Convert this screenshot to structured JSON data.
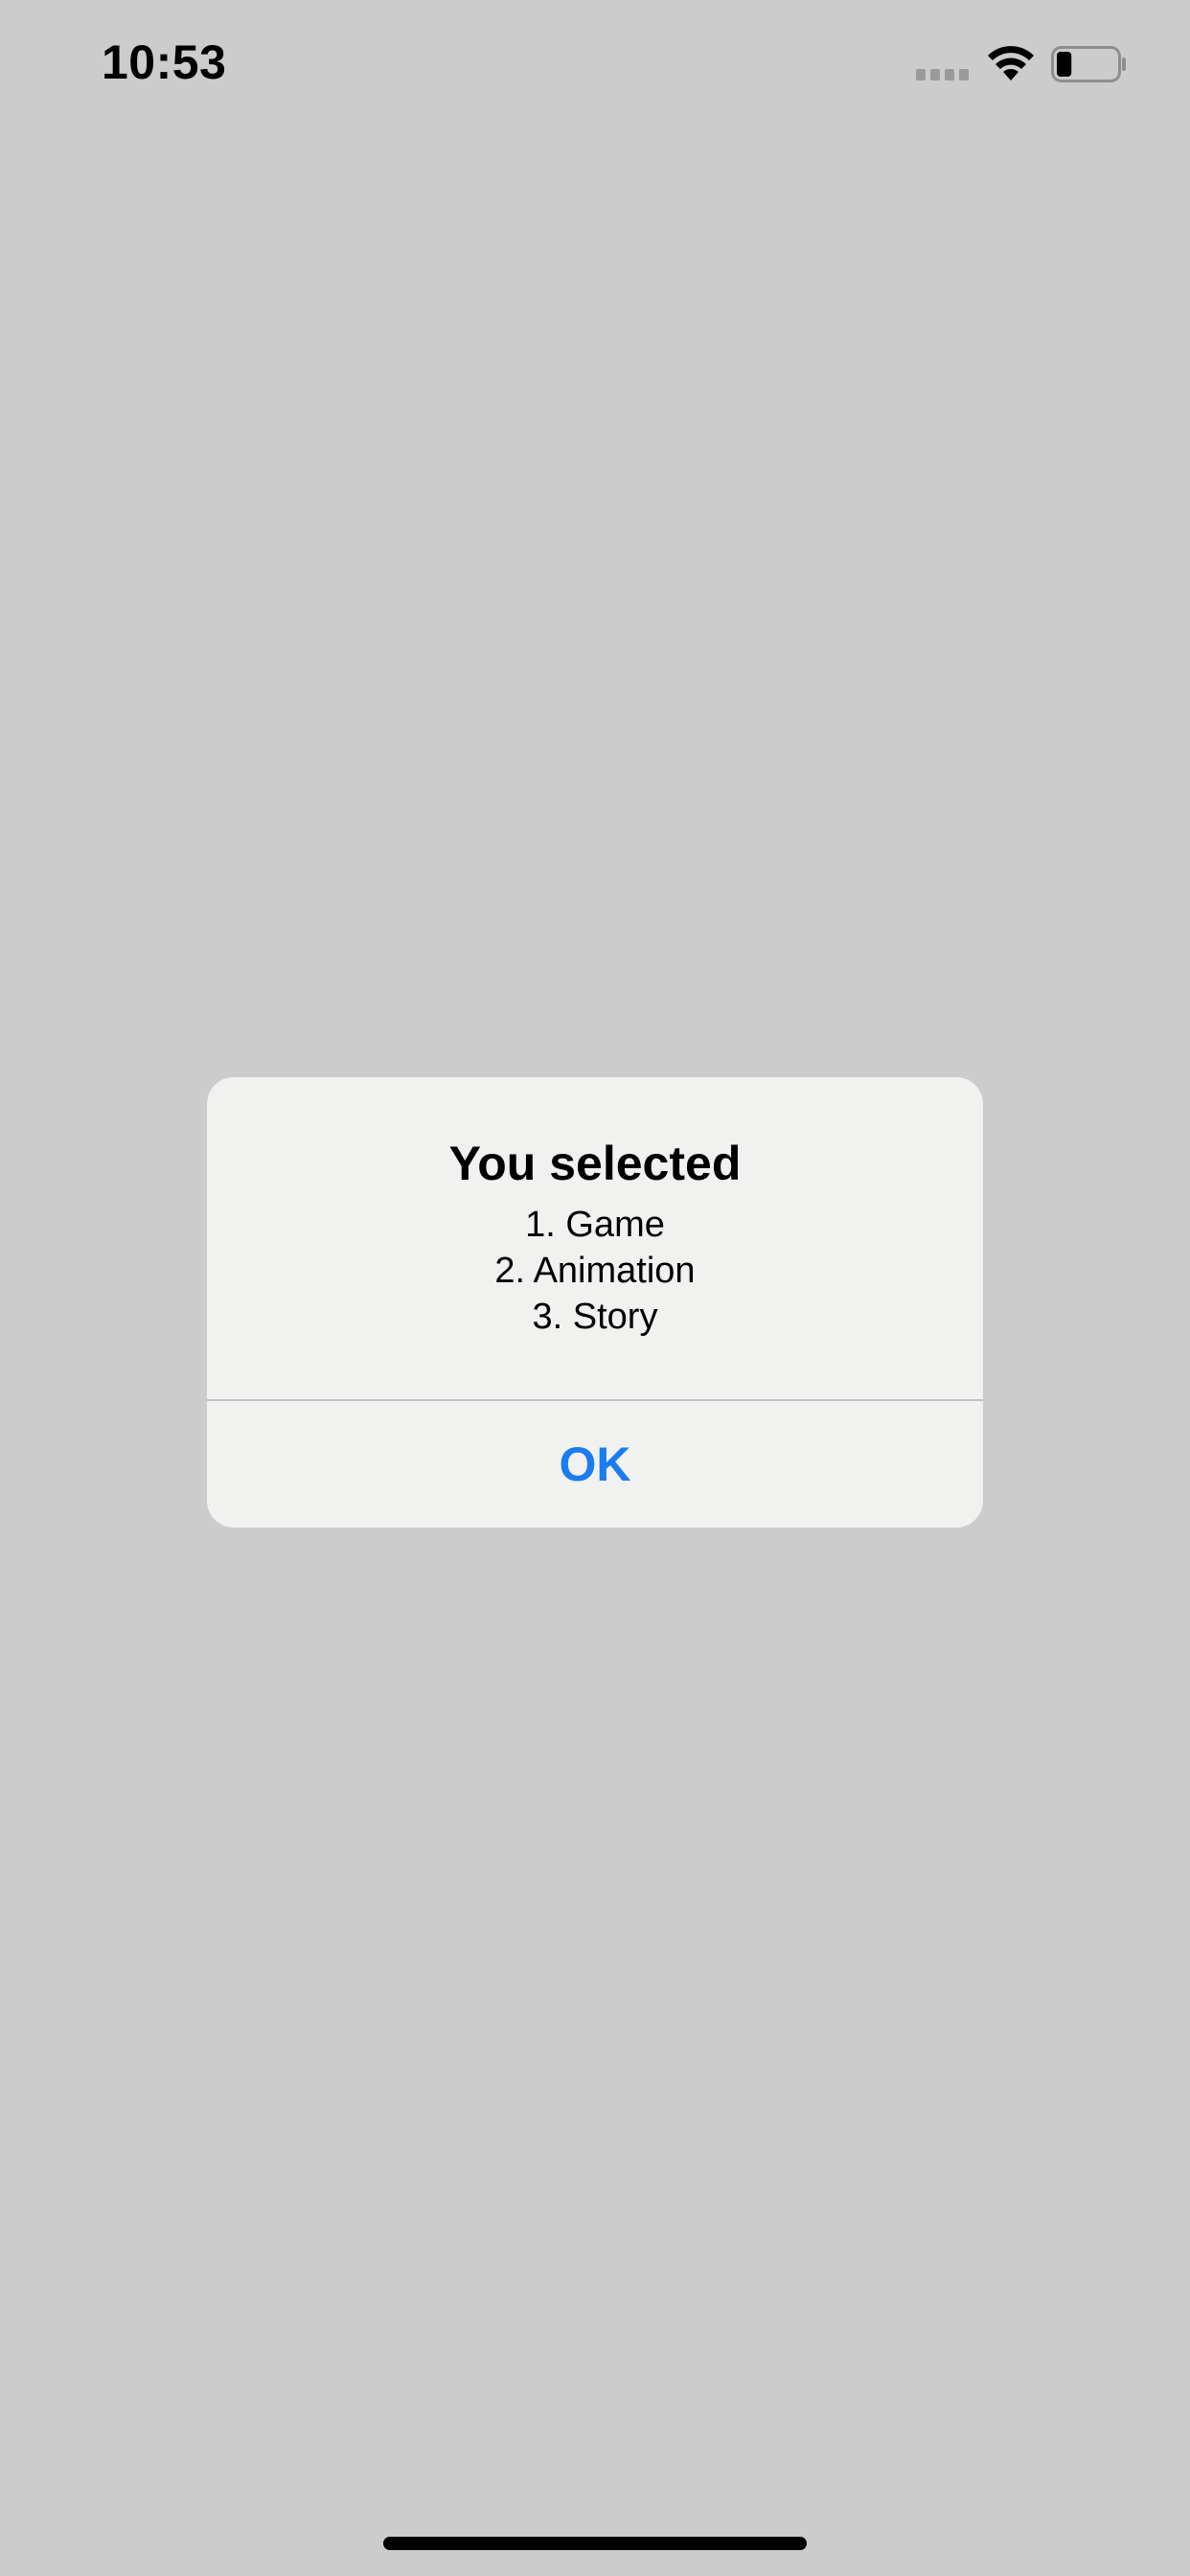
{
  "status_bar": {
    "time": "10:53",
    "signal_icon": "cellular-signal-icon",
    "wifi_icon": "wifi-icon",
    "battery_icon": "battery-icon",
    "battery_level": 0.25
  },
  "alert": {
    "title": "You selected",
    "message_lines": [
      "1. Game",
      "2. Animation",
      "3. Story"
    ],
    "ok_label": "OK"
  },
  "colors": {
    "background": "#cccccc",
    "alert_background": "#f1f1f0",
    "accent": "#1a7cf0"
  }
}
